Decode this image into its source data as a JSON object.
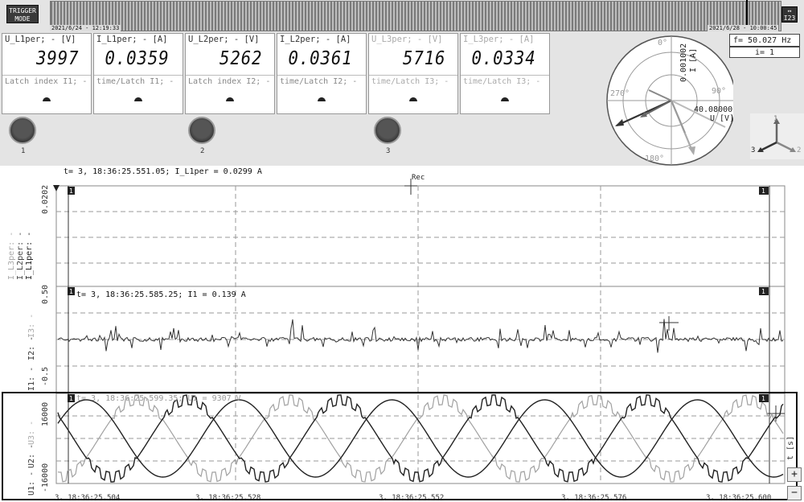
{
  "toolbar": {
    "trigger_mode_line1": "TRIGGER",
    "trigger_mode_line2": "MODE",
    "zoom_button_label": "I23"
  },
  "timeline": {
    "start": "2021/6/24 - 12:19:33",
    "end": "2021/6/28 - 10:00:45"
  },
  "measurements": [
    {
      "label": "U_L1per; - [V]",
      "value": "3997",
      "latch_label": "Latch index I1; -",
      "dim": false
    },
    {
      "label": "I_L1per; - [A]",
      "value": "0.0359",
      "latch_label": "time/Latch I1; -",
      "dim": false
    },
    {
      "label": "U_L2per; - [V]",
      "value": "5262",
      "latch_label": "Latch index I2; -",
      "dim": false
    },
    {
      "label": "I_L2per; - [A]",
      "value": "0.0361",
      "latch_label": "time/Latch I2; -",
      "dim": false
    },
    {
      "label": "U_L3per; - [V]",
      "value": "5716",
      "latch_label": "time/Latch I3; -",
      "dim": true
    },
    {
      "label": "I_L3per; - [A]",
      "value": "0.0334",
      "latch_label": "time/Latch I3; -",
      "dim": true
    }
  ],
  "knobs": [
    "1",
    "2",
    "3"
  ],
  "frequency": "f= 50.027 Hz",
  "index": "i= 1",
  "phasor": {
    "angle_0": "0°",
    "angle_90": "90°",
    "angle_180": "180°",
    "angle_270": "270°",
    "current_scale": "0.001002",
    "current_unit": "I [A]",
    "voltage_scale": "40.08000",
    "voltage_unit": "U [V]"
  },
  "axes3d": {
    "axis1": "1",
    "axis2": "2",
    "axis3": "3"
  },
  "plot1": {
    "readout": "t= 3, 18:36:25.551.05; I_L1per = 0.0299 A",
    "ytick_top": "0.0202",
    "ylabels": [
      "I_L1per: -",
      "I_L2per: -",
      "I_L3per: -"
    ],
    "rec_label": "Rec",
    "marker_left": "1",
    "marker_right": "1"
  },
  "plot2": {
    "readout": "t= 3, 18:36:25.585.25; I1 = 0.139 A",
    "ytick_top": "0.50",
    "ytick_bottom": "-0.5",
    "ylabels": [
      "I1: -",
      "I2: -",
      "I3: -"
    ],
    "marker_left": "1",
    "marker_right": "1"
  },
  "plot3": {
    "readout": "t= 3, 18:36:25.599.35; U1 = 9307 V",
    "ytick_top": "16000",
    "ytick_bottom": "-16000",
    "ylabels": [
      "U1: -",
      "U2: -",
      "U3: -"
    ],
    "x_unit": "t [s]",
    "xticks": [
      "3, 18:36:25.504",
      "3, 18:36:25.528",
      "3, 18:36:25.552",
      "3, 18:36:25.576",
      "3, 18:36:25.600"
    ],
    "marker_left": "1",
    "marker_right": "1"
  },
  "colors": {
    "trace_dark": "#222222",
    "trace_light": "#9a9a9a",
    "panel_bg": "#e4e4e4",
    "grid": "#9a9a9a"
  }
}
